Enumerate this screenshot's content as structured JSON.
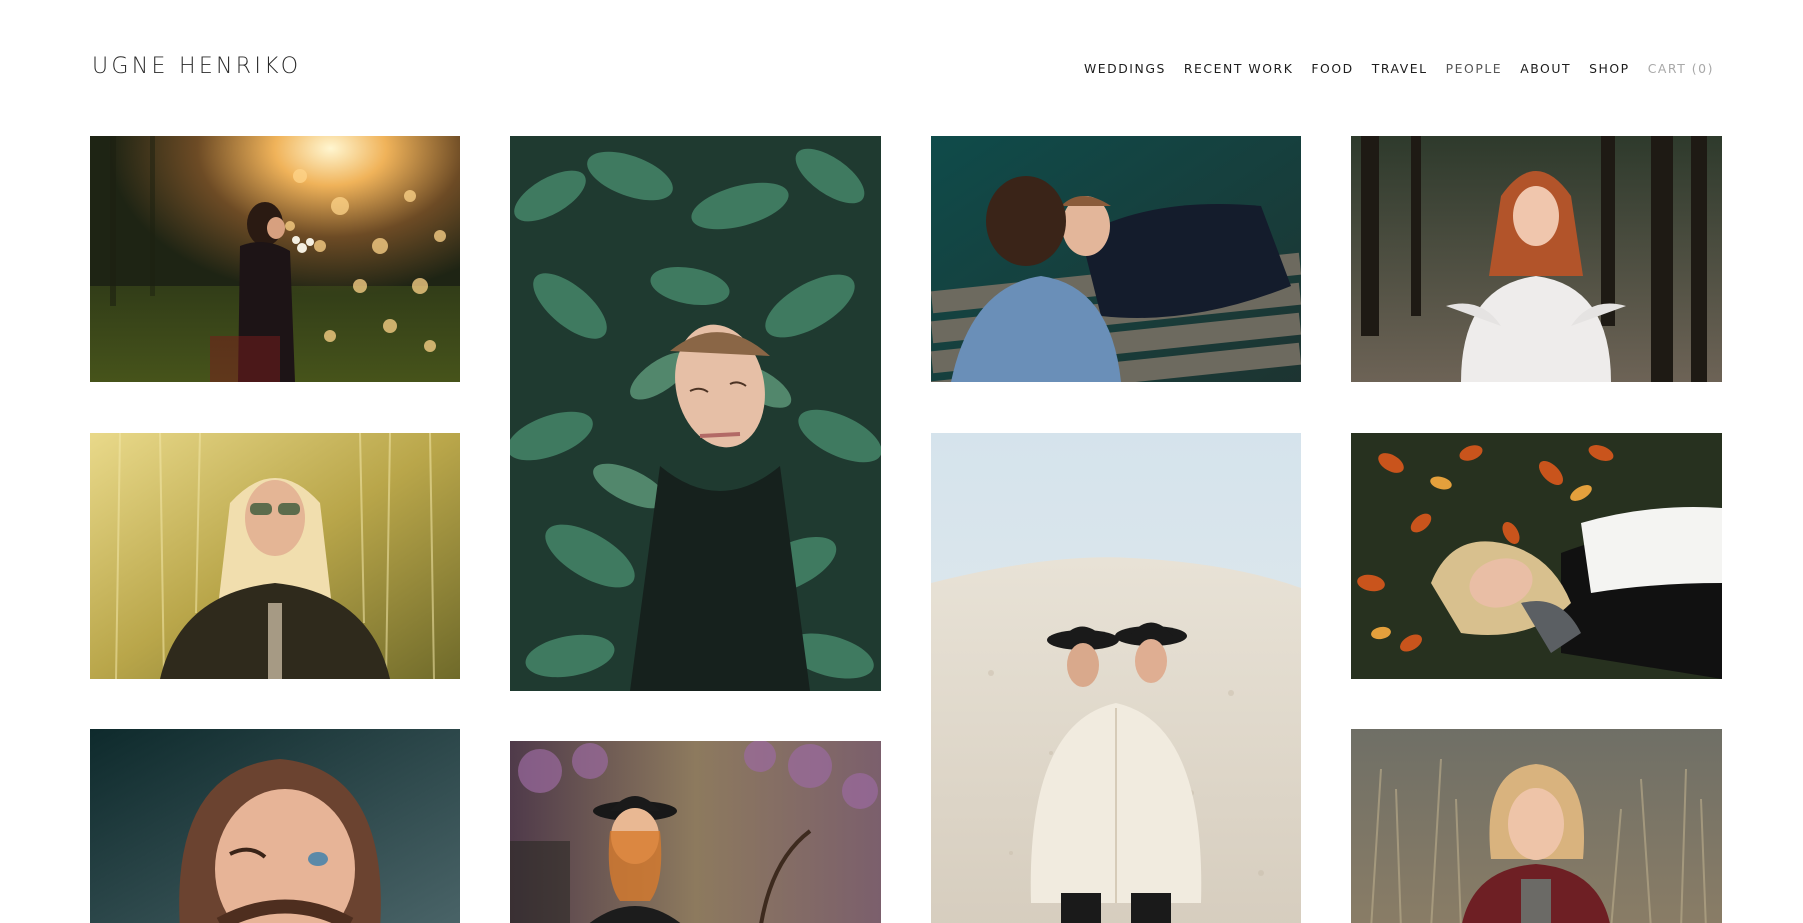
{
  "header": {
    "logo": "UGNE HENRIKO",
    "nav": [
      {
        "label": "WEDDINGS"
      },
      {
        "label": "RECENT WORK"
      },
      {
        "label": "FOOD"
      },
      {
        "label": "TRAVEL"
      },
      {
        "label": "PEOPLE"
      },
      {
        "label": "ABOUT"
      },
      {
        "label": "SHOP"
      },
      {
        "label": "CART (0)"
      }
    ]
  },
  "gallery": {
    "photos": [
      {
        "subject": "woman-with-flowers-sunset-bokeh"
      },
      {
        "subject": "woman-face-in-green-leaves"
      },
      {
        "subject": "couple-lying-on-bench"
      },
      {
        "subject": "redhead-woman-in-forest"
      },
      {
        "subject": "blonde-woman-with-glasses-willow"
      },
      {
        "subject": "two-women-in-hats-fur-coat"
      },
      {
        "subject": "woman-lying-in-autumn-leaves"
      },
      {
        "subject": "woman-winking-hair-mustache"
      },
      {
        "subject": "woman-in-hat-laughing-lilacs"
      },
      {
        "subject": "blonde-woman-in-tall-grass"
      }
    ]
  },
  "colors": {
    "text": "#1b1b1b",
    "cart": "#a8a8a8",
    "background": "#ffffff"
  }
}
